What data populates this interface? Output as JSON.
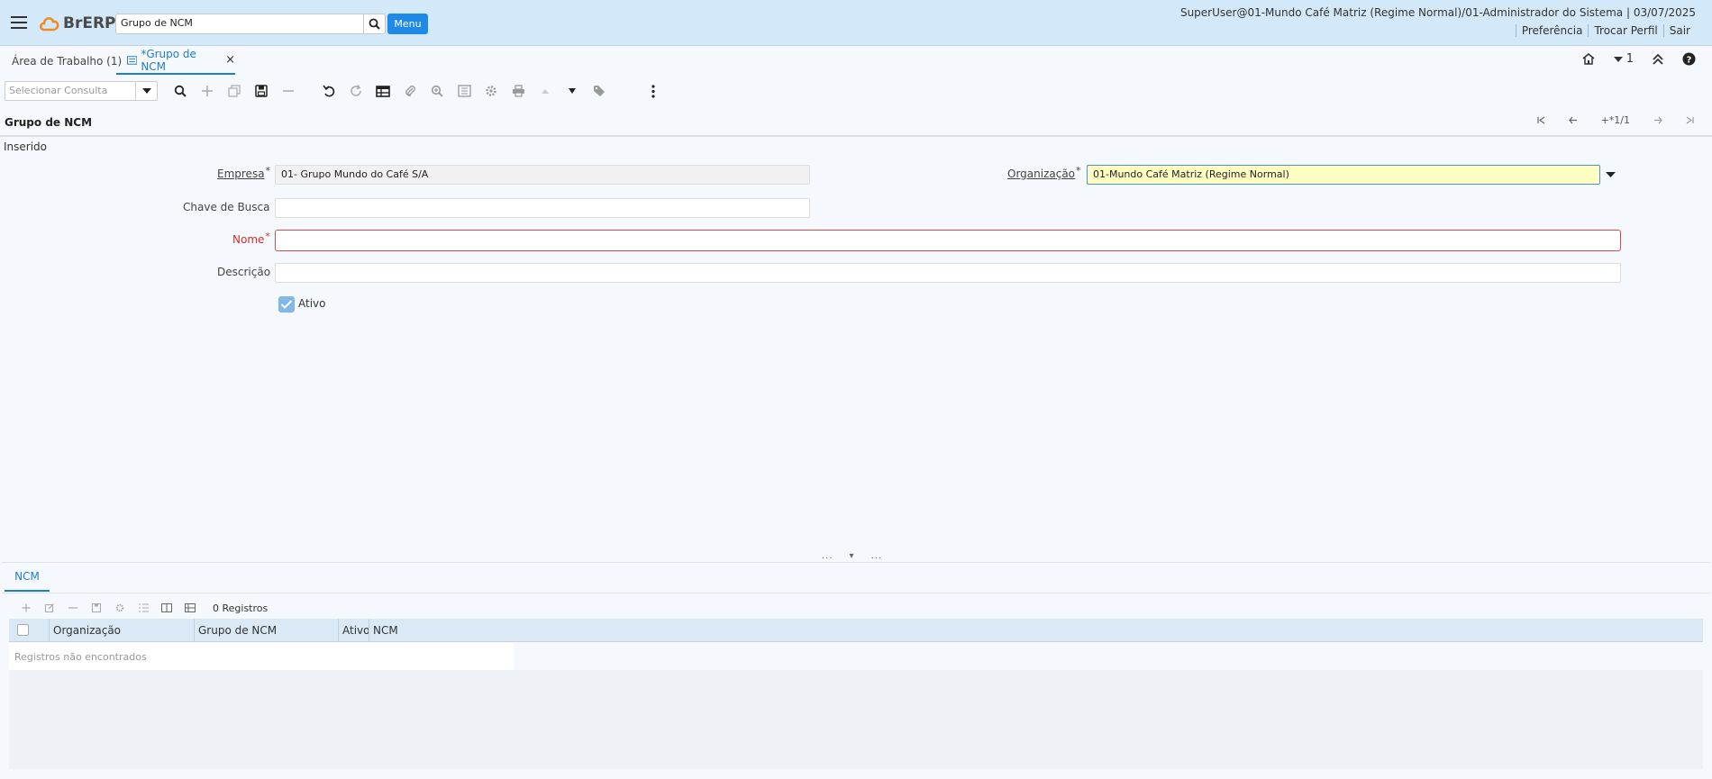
{
  "header": {
    "logo_text": "BrERP",
    "search_value": "Grupo de NCM",
    "menu_label": "Menu",
    "user_info": "SuperUser@01-Mundo Café Matriz (Regime Normal)/01-Administrador do Sistema | 03/07/2025",
    "links": [
      "Preferência",
      "Trocar Perfil",
      "Sair"
    ]
  },
  "tabs": {
    "workspace": "Área de Trabalho (1)",
    "active": "*Grupo de NCM",
    "close": "×",
    "count": "1"
  },
  "toolbar": {
    "query_placeholder": "Selecionar Consulta"
  },
  "form": {
    "title": "Grupo de NCM",
    "navigation": "+*1/1",
    "status": "Inserido",
    "fields": {
      "empresa_label": "Empresa",
      "empresa_value": "01- Grupo Mundo do Café S/A",
      "organizacao_label": "Organização",
      "organizacao_value": "01-Mundo Café Matriz (Regime Normal)",
      "chave_label": "Chave de Busca",
      "chave_value": "",
      "nome_label": "Nome",
      "nome_value": "",
      "descricao_label": "Descrição",
      "descricao_value": "",
      "ativo_label": "Ativo",
      "ativo_checked": true
    }
  },
  "splitter": [
    "...",
    "▾",
    "..."
  ],
  "detail": {
    "tab_label": "NCM",
    "record_count": "0 Registros",
    "columns": [
      "Organização",
      "Grupo de NCM",
      "Ativo",
      "NCM"
    ],
    "empty_text": "Registros não encontrados"
  },
  "colors": {
    "header_bg": "#d3e8f8",
    "accent": "#1d7dd0",
    "logo_orange": "#f08a24",
    "error": "#d32f2f",
    "highlight": "#ffffc4"
  },
  "icons": {
    "toolbar": [
      "search-icon",
      "new-icon",
      "copy-icon",
      "save-icon",
      "delete-icon",
      "undo-icon",
      "refresh-icon",
      "grid-toggle-icon",
      "attachment-icon",
      "zoom-icon",
      "report-icon",
      "process-icon",
      "print-icon",
      "up-icon",
      "down-icon",
      "tag-icon",
      "more-icon"
    ]
  }
}
